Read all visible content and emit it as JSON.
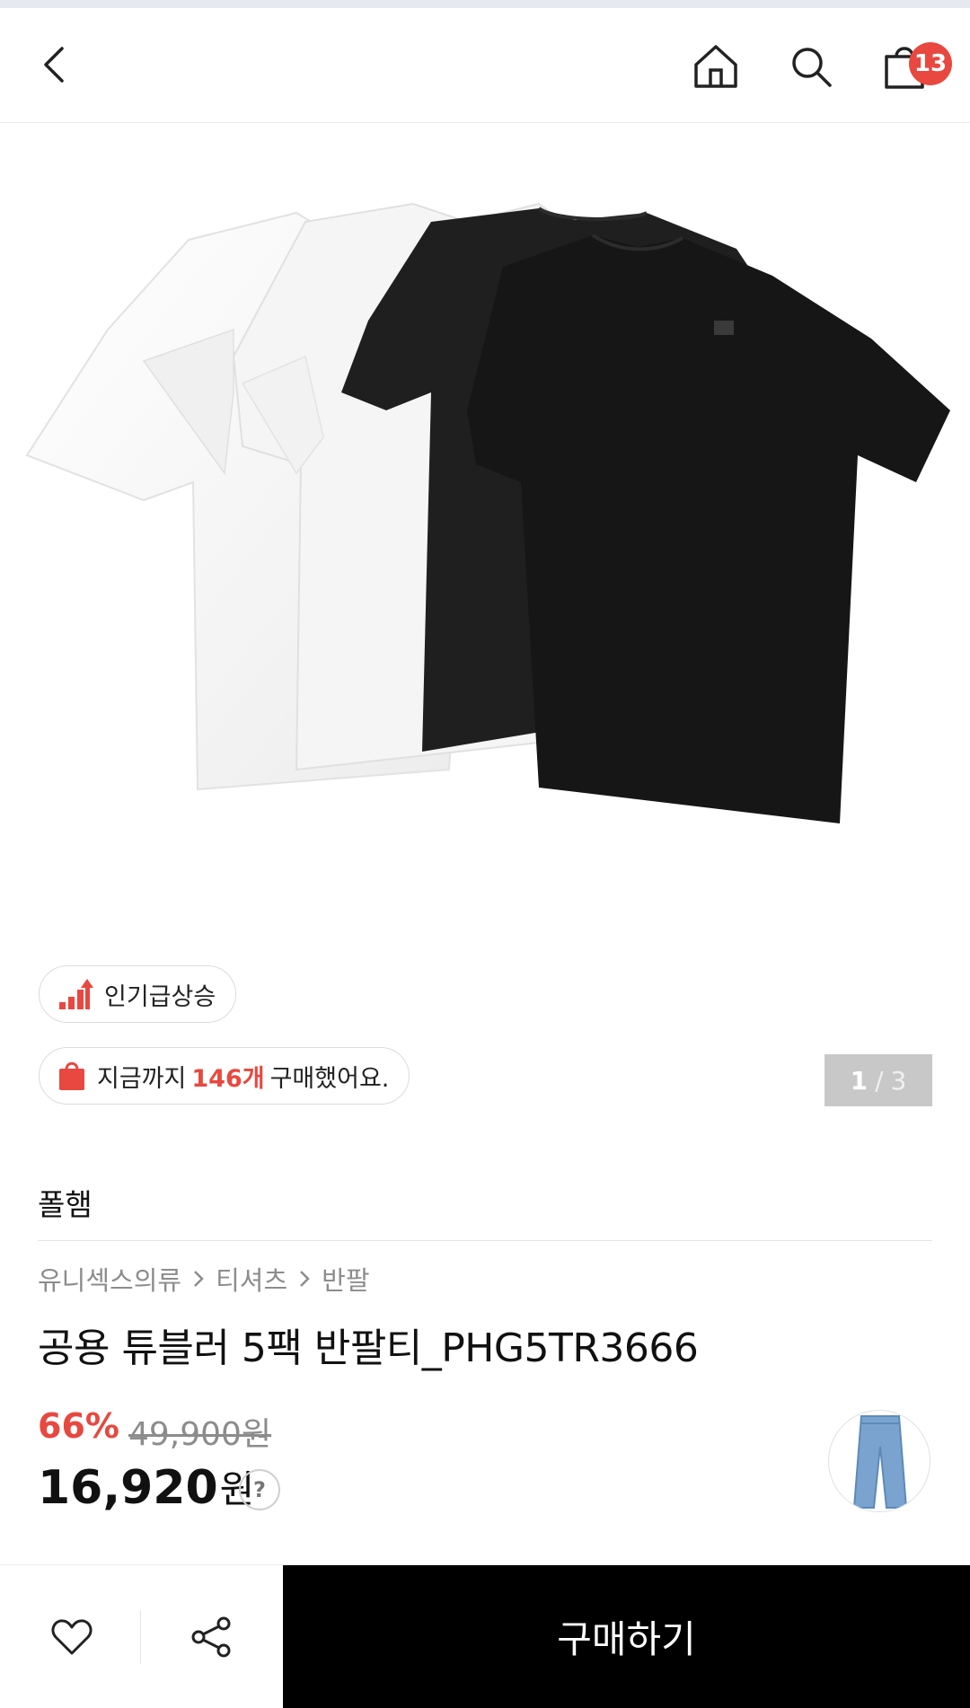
{
  "header": {
    "back_icon": "chevron-left-icon",
    "home_icon": "home-icon",
    "search_icon": "search-icon",
    "cart_icon": "shopping-bag-icon",
    "cart_count": "13"
  },
  "hero": {
    "image_desc_icon": "product-image",
    "pager": {
      "current": "1",
      "separator": "/",
      "total": "3"
    }
  },
  "badges": {
    "trending_label": "인기급상승",
    "purchase_prefix": "지금까지",
    "purchase_count": "146개",
    "purchase_suffix": "구매했어요."
  },
  "product": {
    "brand": "폴햄",
    "breadcrumb": [
      "유니섹스의류",
      "티셔츠",
      "반팔"
    ],
    "title": "공용 튜블러 5팩 반팔티_PHG5TR3666",
    "discount": "66%",
    "original_price": "49,900원",
    "price_number": "16,920",
    "price_unit": "원",
    "price_help": "?"
  },
  "bottom": {
    "wish_icon": "heart-icon",
    "share_icon": "share-icon",
    "buy_label": "구매하기"
  },
  "colors": {
    "accent": "#e8483f",
    "buy_bg": "#000000",
    "muted": "#8c8c8c"
  }
}
